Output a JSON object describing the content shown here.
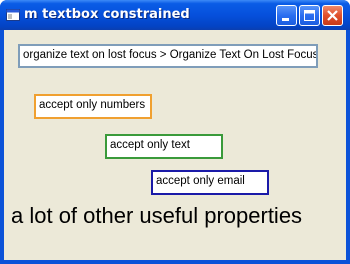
{
  "window": {
    "title": "m textbox constrained"
  },
  "textboxes": {
    "organize": "organize text on lost focus > Organize Text On Lost Focus",
    "numbers": "accept only numbers",
    "text": "accept only text",
    "email": "accept only email"
  },
  "label": {
    "properties": "a lot of other useful properties"
  },
  "icons": {
    "app": "app-window-icon",
    "minimize": "minimize-icon",
    "maximize": "maximize-icon",
    "close": "close-icon"
  },
  "colors": {
    "titlebar": "#0650dc",
    "client_background": "#ece9d8",
    "numbers_border": "#f0a030",
    "text_border": "#3a9a3a",
    "email_border": "#1a1aa8",
    "organize_border": "#7f9db9",
    "close_button": "#e0502c"
  }
}
